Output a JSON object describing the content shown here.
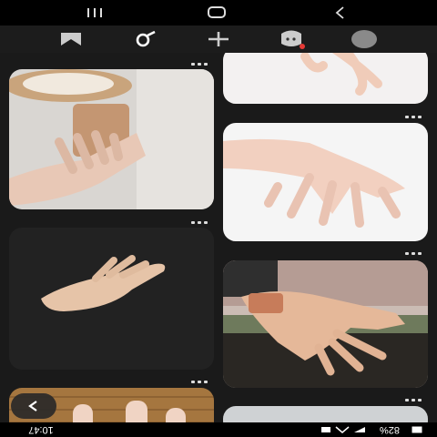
{
  "navigation": {
    "recents_icon": "recents-icon",
    "home_icon": "home-icon",
    "back_icon": "back-icon"
  },
  "tabs": [
    {
      "icon": "bookmark-icon",
      "active": false
    },
    {
      "icon": "search-icon",
      "active": true
    },
    {
      "icon": "add-icon",
      "active": false
    },
    {
      "icon": "notifications-icon",
      "active": false,
      "badge": true
    },
    {
      "icon": "profile-icon",
      "active": false
    }
  ],
  "feed": {
    "left_column": [
      "coffee-hand-photo",
      "dark-hand-photo",
      "wood-fingers-photo"
    ],
    "right_column": [
      "white-hand-top-photo",
      "white-hand-photo",
      "tattoo-hand-photo",
      "gray-card-photo"
    ]
  },
  "status_bar": {
    "time": "10:47",
    "battery": "82%"
  },
  "colors": {
    "background": "#1a1a1a",
    "badge": "#e53935"
  }
}
